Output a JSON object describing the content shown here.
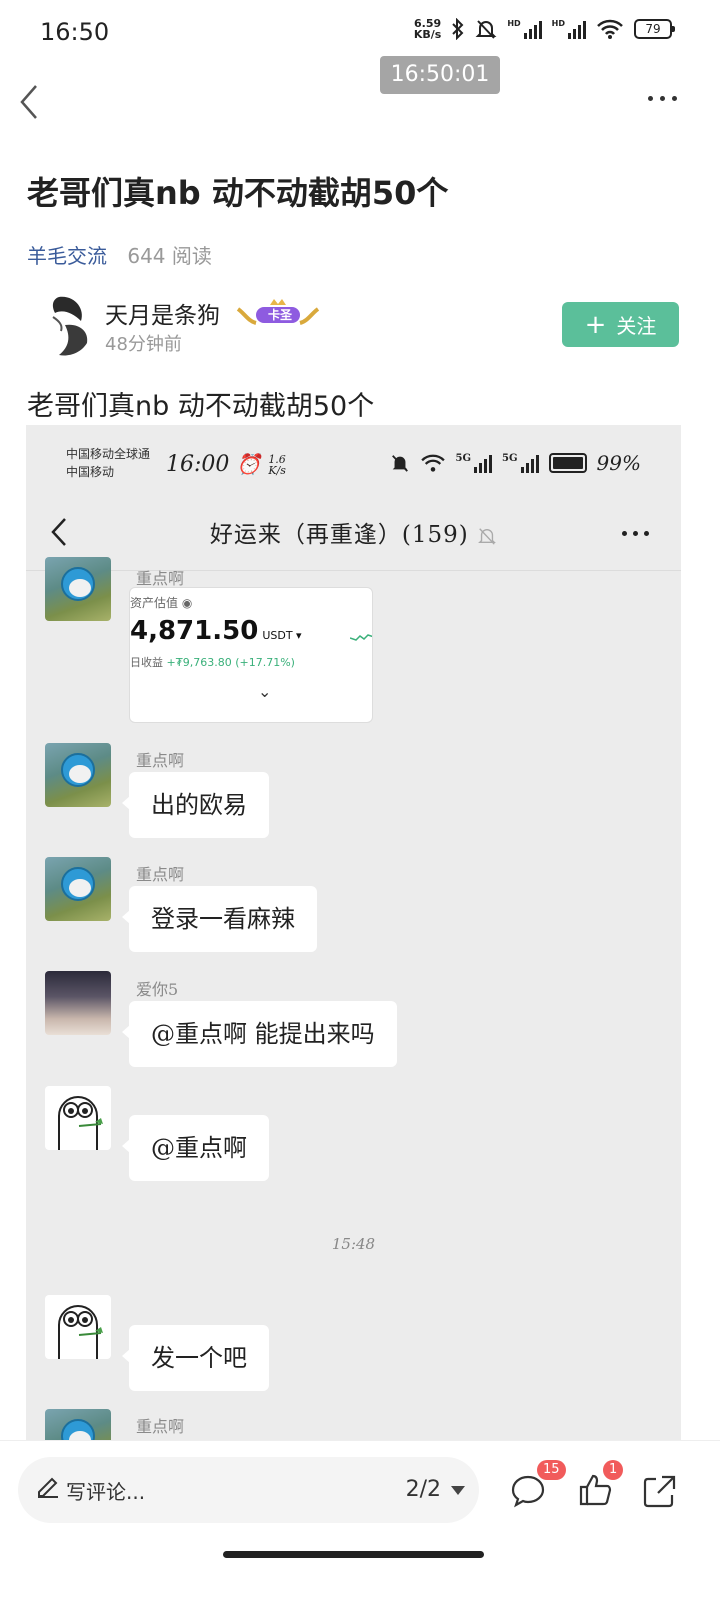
{
  "status_bar": {
    "time": "16:50",
    "net_speed_value": "6.59",
    "net_speed_unit": "KB/s",
    "sim1_tag": "HD",
    "sim2_tag": "HD",
    "battery": "79"
  },
  "nav": {
    "timestamp": "16:50:01"
  },
  "post": {
    "title": "老哥们真nb 动不动截胡50个",
    "category": "羊毛交流",
    "reads": "644 阅读",
    "author": "天月是条狗",
    "badge_text": "卡圣",
    "time_ago": "48分钟前",
    "follow_label": "关注",
    "body": "老哥们真nb 动不动截胡50个"
  },
  "screenshot": {
    "carrier_line1": "中国移动全球通",
    "carrier_line2": "中国移动",
    "time": "16:00",
    "speed_top": "1.6",
    "speed_bottom": "K/s",
    "battery_pct": "99%",
    "net_tag_1": "5G",
    "net_tag_2": "5G",
    "chat_title": "好运来（再重逢）(159)",
    "asset_card": {
      "label": "资产估值",
      "amount": "4,871.50",
      "unit": "USDT ▾",
      "profit_label": "日收益",
      "profit_value": "+₮9,763.80 (+17.71%)",
      "chevron": "⌄"
    },
    "messages": [
      {
        "sender": "重点啊",
        "text": "出的欧易"
      },
      {
        "sender": "重点啊",
        "text": "登录一看麻辣"
      },
      {
        "sender": "爱你5",
        "text": "@重点啊  能提出来吗"
      },
      {
        "sender": "",
        "text": "@重点啊"
      },
      {
        "sender": "",
        "text": "发一个吧"
      }
    ],
    "top_sender": "重点啊",
    "bottom_sender": "重点啊",
    "divider_time": "15:48"
  },
  "bottom": {
    "comment_placeholder": "写评论...",
    "page_indicator": "2/2",
    "comment_count": "15",
    "like_count": "1"
  }
}
